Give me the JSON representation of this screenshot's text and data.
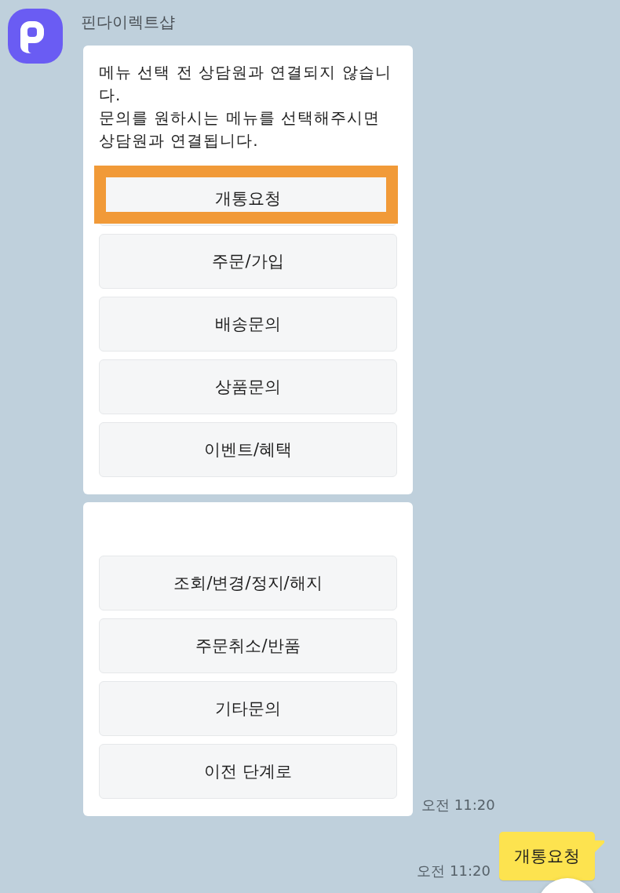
{
  "sender": {
    "name": "핀다이렉트샵"
  },
  "incoming": {
    "cards": [
      {
        "text": "메뉴 선택 전 상담원과 연결되지 않습니다.\n문의를 원하시는 메뉴를 선택해주시면\n상담원과 연결됩니다.",
        "options": [
          {
            "label": "개통요청",
            "highlighted": true
          },
          {
            "label": "주문/가입",
            "highlighted": false
          },
          {
            "label": "배송문의",
            "highlighted": false
          },
          {
            "label": "상품문의",
            "highlighted": false
          },
          {
            "label": "이벤트/혜택",
            "highlighted": false
          }
        ]
      },
      {
        "options": [
          {
            "label": "조회/변경/정지/해지",
            "highlighted": false
          },
          {
            "label": "주문취소/반품",
            "highlighted": false
          },
          {
            "label": "기타문의",
            "highlighted": false
          },
          {
            "label": "이전 단계로",
            "highlighted": false
          }
        ]
      }
    ],
    "time": "오전 11:20"
  },
  "outgoing": {
    "text": "개통요청",
    "time": "오전 11:20"
  }
}
